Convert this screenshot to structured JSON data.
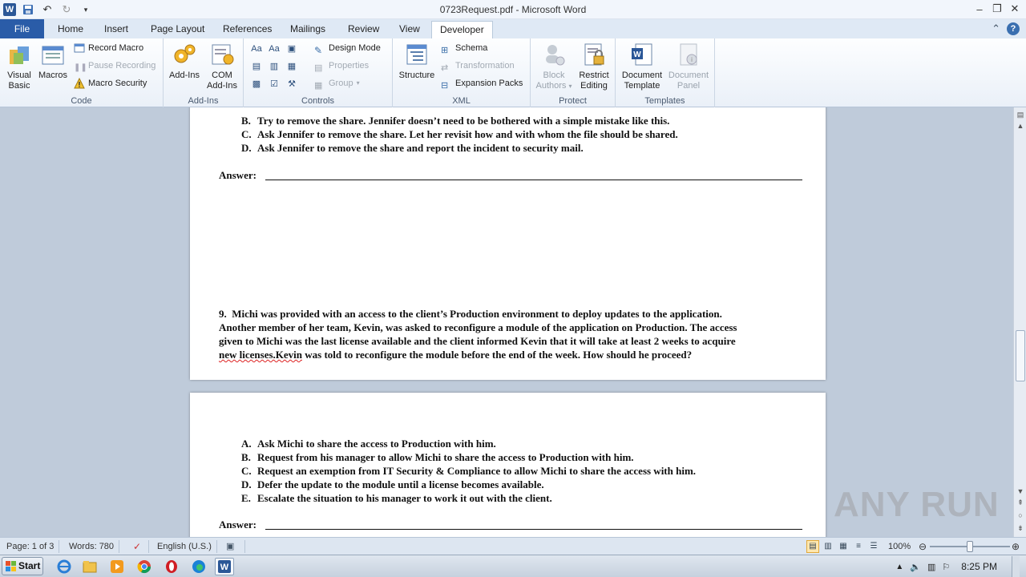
{
  "window": {
    "title": "0723Request.pdf - Microsoft Word",
    "app_icon": "W"
  },
  "tabs": [
    "File",
    "Home",
    "Insert",
    "Page Layout",
    "References",
    "Mailings",
    "Review",
    "View",
    "Developer"
  ],
  "active_tab": "Developer",
  "ribbon": {
    "code": {
      "label": "Code",
      "visual_basic": "Visual Basic",
      "macros": "Macros",
      "record_macro": "Record Macro",
      "pause_recording": "Pause Recording",
      "macro_security": "Macro Security"
    },
    "addins": {
      "label": "Add-Ins",
      "add_ins": "Add-Ins",
      "com_add_ins": "COM Add-Ins"
    },
    "controls": {
      "label": "Controls",
      "design_mode": "Design Mode",
      "properties": "Properties",
      "group": "Group"
    },
    "xml": {
      "label": "XML",
      "structure": "Structure",
      "schema": "Schema",
      "transformation": "Transformation",
      "expansion_packs": "Expansion Packs"
    },
    "protect": {
      "label": "Protect",
      "block_authors": "Block Authors",
      "restrict_editing": "Restrict Editing"
    },
    "templates": {
      "label": "Templates",
      "document_template": "Document Template",
      "document_panel": "Document Panel"
    }
  },
  "document": {
    "q8_options": [
      {
        "letter": "B.",
        "text": "Try to remove the share. Jennifer doesn’t need to be bothered with a simple mistake like this."
      },
      {
        "letter": "C.",
        "text": "Ask Jennifer to remove the share. Let her revisit how and with whom the file should be shared."
      },
      {
        "letter": "D.",
        "text": "Ask Jennifer to remove the share and report the incident to security mail."
      }
    ],
    "answer_label": "Answer:",
    "q9": {
      "number": "9.",
      "line1": "Michi was provided with an access to the client’s Production environment to deploy updates to the application.",
      "line2": "Another member of her team, Kevin, was asked to reconfigure a module of the application on Production. The access",
      "line3": "given to Michi was the last license available and the client informed Kevin that it will take at least 2 weeks to acquire",
      "line4_misspelled": "new licenses.Kevin",
      "line4_rest": " was told to reconfigure the module before the end of the week. How should he proceed?"
    },
    "q9_options": [
      {
        "letter": "A.",
        "text": "Ask Michi to share the access to Production with him."
      },
      {
        "letter": "B.",
        "text": "Request from his manager to allow Michi to share the access to Production with him."
      },
      {
        "letter": "C.",
        "text": "Request an exemption from IT Security & Compliance to allow Michi to share the access with him."
      },
      {
        "letter": "D.",
        "text": "Defer the update to the module until a license becomes available."
      },
      {
        "letter": "E.",
        "text": "Escalate the situation to his manager to work it out with the client."
      }
    ]
  },
  "statusbar": {
    "page": "Page: 1 of 3",
    "words": "Words: 780",
    "language": "English (U.S.)",
    "zoom": "100%"
  },
  "taskbar": {
    "start": "Start",
    "clock": "8:25 PM"
  },
  "watermark": "ANY RUN"
}
